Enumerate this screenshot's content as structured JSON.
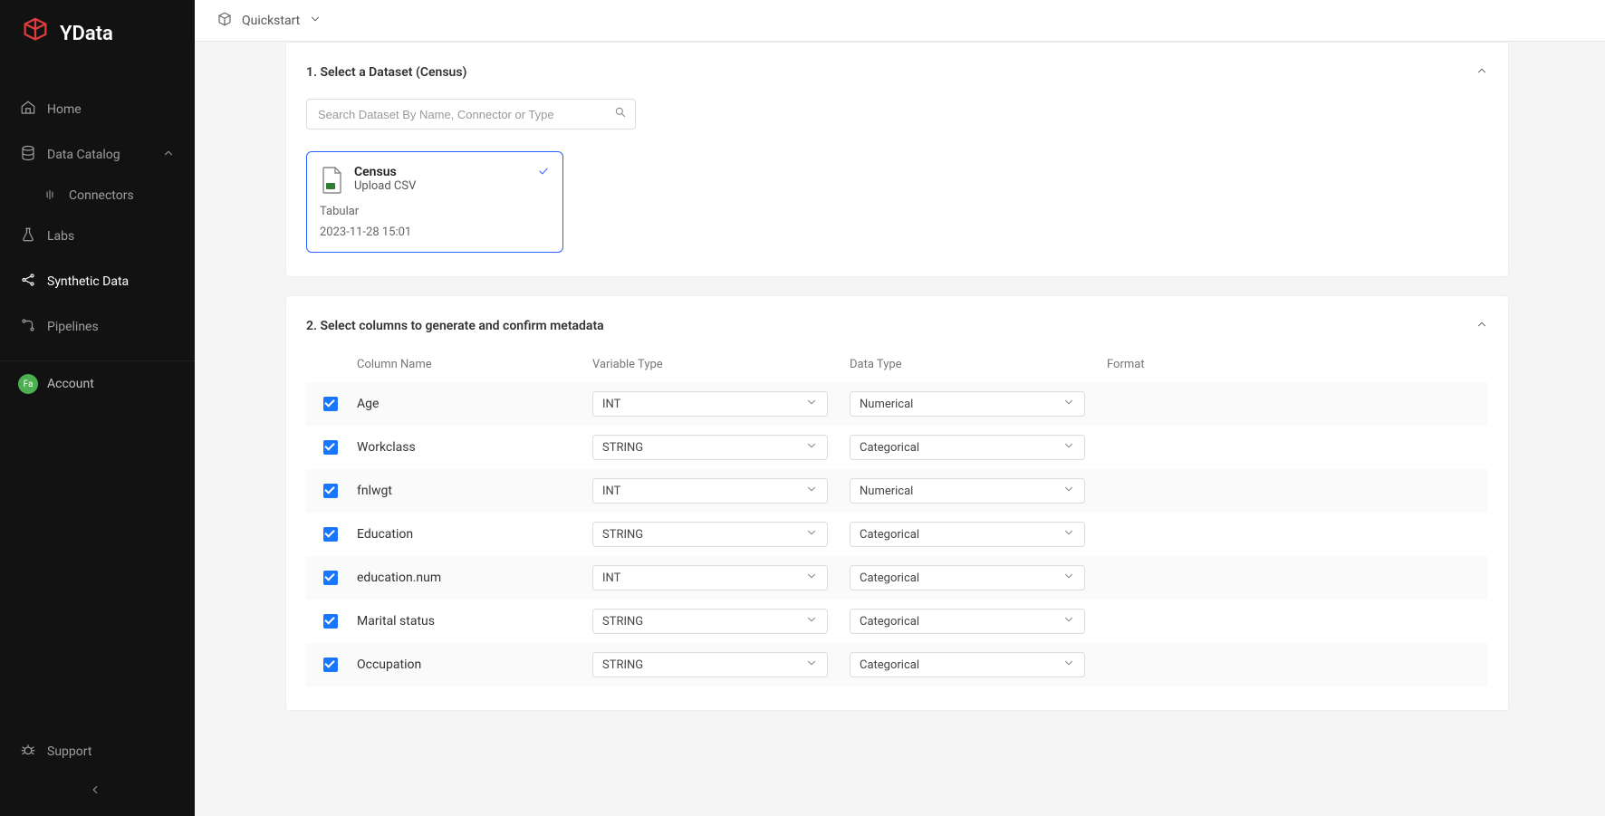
{
  "brand": {
    "name": "YData"
  },
  "topbar": {
    "title": "Quickstart"
  },
  "sidebar": {
    "items": [
      {
        "label": "Home"
      },
      {
        "label": "Data Catalog"
      },
      {
        "label": "Connectors"
      },
      {
        "label": "Labs"
      },
      {
        "label": "Synthetic Data"
      },
      {
        "label": "Pipelines"
      }
    ],
    "account_label": "Account",
    "account_initials": "Fa",
    "support_label": "Support"
  },
  "step1": {
    "title": "1. Select a Dataset",
    "selected_suffix": "(Census)",
    "search_placeholder": "Search Dataset By Name, Connector or Type",
    "dataset": {
      "name": "Census",
      "subtitle": "Upload CSV",
      "type": "Tabular",
      "timestamp": "2023-11-28 15:01"
    }
  },
  "step2": {
    "title": "2. Select columns to generate and confirm metadata",
    "headers": {
      "col_name": "Column Name",
      "var_type": "Variable Type",
      "data_type": "Data Type",
      "format": "Format"
    },
    "rows": [
      {
        "name": "Age",
        "var_type": "INT",
        "data_type": "Numerical"
      },
      {
        "name": "Workclass",
        "var_type": "STRING",
        "data_type": "Categorical"
      },
      {
        "name": "fnlwgt",
        "var_type": "INT",
        "data_type": "Numerical"
      },
      {
        "name": "Education",
        "var_type": "STRING",
        "data_type": "Categorical"
      },
      {
        "name": "education.num",
        "var_type": "INT",
        "data_type": "Categorical"
      },
      {
        "name": "Marital status",
        "var_type": "STRING",
        "data_type": "Categorical"
      },
      {
        "name": "Occupation",
        "var_type": "STRING",
        "data_type": "Categorical"
      }
    ]
  }
}
